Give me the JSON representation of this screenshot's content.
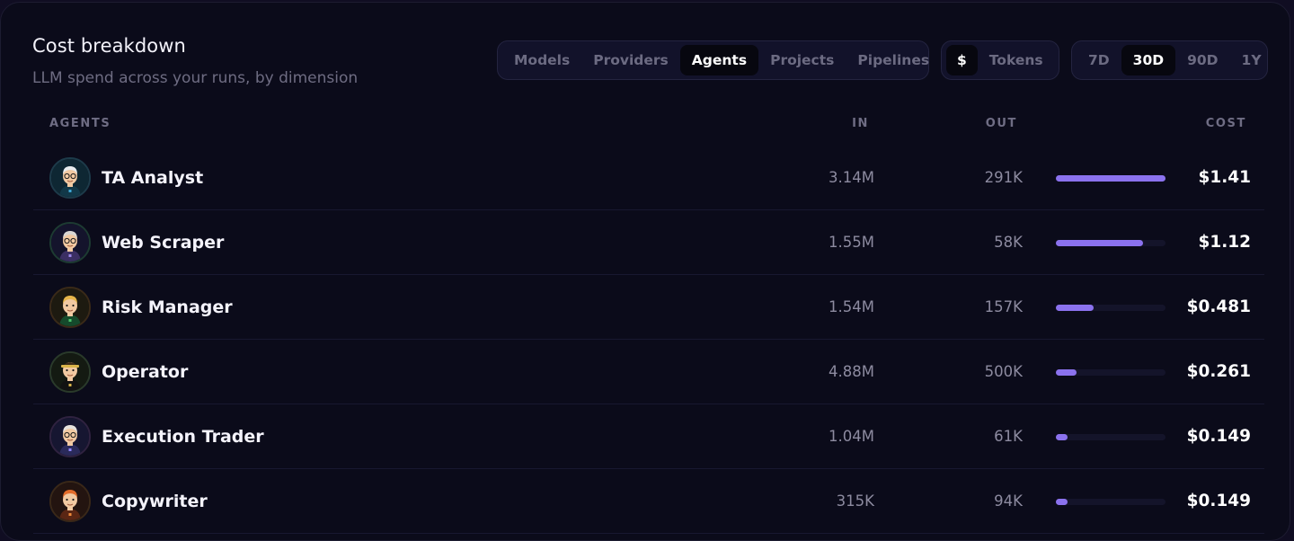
{
  "header": {
    "title": "Cost breakdown",
    "subtitle": "LLM spend across your runs, by dimension"
  },
  "dimension_tabs": [
    "Models",
    "Providers",
    "Agents",
    "Projects",
    "Pipelines"
  ],
  "dimension_selected": "Agents",
  "unit_tabs": [
    "$",
    "Tokens"
  ],
  "unit_selected": "$",
  "range_tabs": [
    "7D",
    "30D",
    "90D",
    "1Y"
  ],
  "range_selected": "30D",
  "table": {
    "headers": {
      "agents": "AGENTS",
      "in": "IN",
      "out": "OUT",
      "cost": "COST"
    },
    "rows": [
      {
        "name": "TA Analyst",
        "in": "3.14M",
        "out": "291K",
        "cost": "$1.41",
        "cost_value": 1.41,
        "avatar": "ta-analyst-avatar-icon"
      },
      {
        "name": "Web Scraper",
        "in": "1.55M",
        "out": "58K",
        "cost": "$1.12",
        "cost_value": 1.12,
        "avatar": "web-scraper-avatar-icon"
      },
      {
        "name": "Risk Manager",
        "in": "1.54M",
        "out": "157K",
        "cost": "$0.481",
        "cost_value": 0.481,
        "avatar": "risk-manager-avatar-icon"
      },
      {
        "name": "Operator",
        "in": "4.88M",
        "out": "500K",
        "cost": "$0.261",
        "cost_value": 0.261,
        "avatar": "operator-avatar-icon"
      },
      {
        "name": "Execution Trader",
        "in": "1.04M",
        "out": "61K",
        "cost": "$0.149",
        "cost_value": 0.149,
        "avatar": "execution-trader-avatar-icon"
      },
      {
        "name": "Copywriter",
        "in": "315K",
        "out": "94K",
        "cost": "$0.149",
        "cost_value": 0.149,
        "avatar": "copywriter-avatar-icon"
      }
    ]
  },
  "colors": {
    "accent": "#8b72ee",
    "background": "#0b0b1a"
  }
}
